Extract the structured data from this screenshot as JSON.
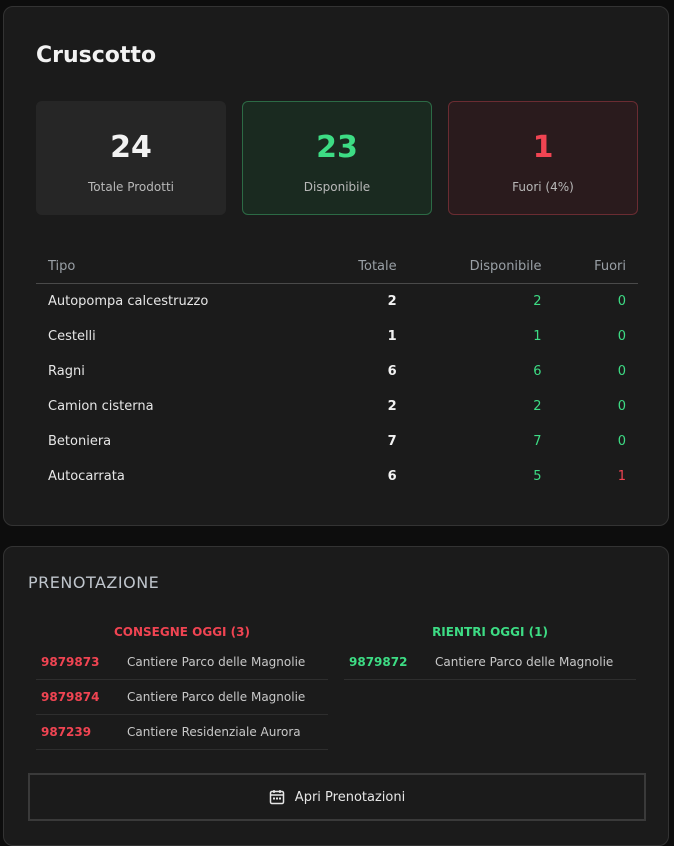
{
  "dashboard": {
    "title": "Cruscotto",
    "stats": {
      "total": {
        "value": "24",
        "label": "Totale Prodotti"
      },
      "available": {
        "value": "23",
        "label": "Disponibile"
      },
      "out": {
        "value": "1",
        "label": "Fuori (4%)"
      }
    },
    "table": {
      "headers": [
        "Tipo",
        "Totale",
        "Disponibile",
        "Fuori"
      ],
      "rows": [
        [
          "Autopompa calcestruzzo",
          "2",
          "2",
          "0"
        ],
        [
          "Cestelli",
          "1",
          "1",
          "0"
        ],
        [
          "Ragni",
          "6",
          "6",
          "0"
        ],
        [
          "Camion cisterna",
          "2",
          "2",
          "0"
        ],
        [
          "Betoniera",
          "7",
          "7",
          "0"
        ],
        [
          "Autocarrata",
          "6",
          "5",
          "1"
        ]
      ]
    }
  },
  "prenotazione": {
    "title": "PRENOTAZIONE",
    "deliveries": {
      "heading": "CONSEGNE OGGI (3)",
      "items": [
        [
          "9879873",
          "Cantiere Parco delle Magnolie"
        ],
        [
          "9879874",
          "Cantiere Parco delle Magnolie"
        ],
        [
          "987239",
          "Cantiere Residenziale Aurora"
        ]
      ]
    },
    "returns": {
      "heading": "RIENTRI OGGI (1)",
      "items": [
        [
          "9879872",
          "Cantiere Parco delle Magnolie"
        ]
      ]
    },
    "open_button": {
      "label": "Apri Prenotazioni",
      "icon": "calendar-icon"
    }
  },
  "colors": {
    "green": "#3ddc84",
    "red": "#f04452",
    "panel": "#1b1b1b"
  }
}
